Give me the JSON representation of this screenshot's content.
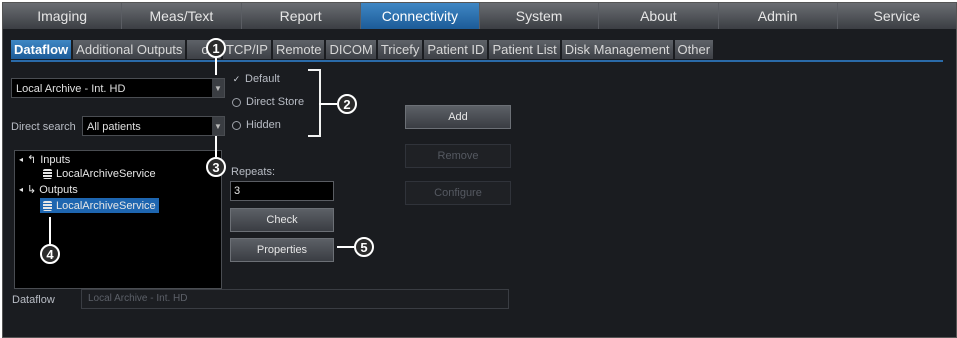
{
  "top_tabs": [
    "Imaging",
    "Meas/Text",
    "Report",
    "Connectivity",
    "System",
    "About",
    "Admin",
    "Service"
  ],
  "active_top_tab": "Connectivity",
  "sub_tabs": [
    "Dataflow",
    "Additional Outputs",
    "Tools",
    "TCP/IP",
    "Remote",
    "DICOM",
    "Tricefy",
    "Patient ID",
    "Patient List",
    "Disk Management",
    "Other"
  ],
  "sub_tabs_visible": [
    "Dataflow",
    "Additional Outputs",
    "ols",
    "TCP/IP",
    "Remote",
    "DICOM",
    "Tricefy",
    "Patient ID",
    "Patient List",
    "Disk Management",
    "Other"
  ],
  "dataflow_select": {
    "value": "Local Archive - Int. HD"
  },
  "direct_search": {
    "label": "Direct search",
    "value": "All patients"
  },
  "options": [
    {
      "label": "Default",
      "checked": true
    },
    {
      "label": "Direct Store",
      "checked": false
    },
    {
      "label": "Hidden",
      "checked": false
    }
  ],
  "tree": {
    "inputs_label": "Inputs",
    "input_service": "LocalArchiveService",
    "outputs_label": "Outputs",
    "output_service": "LocalArchiveService"
  },
  "repeats": {
    "label": "Repeats:",
    "value": "3"
  },
  "buttons": {
    "add": "Add",
    "remove": "Remove",
    "configure": "Configure",
    "check": "Check",
    "properties": "Properties"
  },
  "dataflow_field": {
    "label": "Dataflow",
    "value": "Local Archive - Int. HD"
  },
  "callouts": [
    "1",
    "2",
    "3",
    "4",
    "5"
  ]
}
